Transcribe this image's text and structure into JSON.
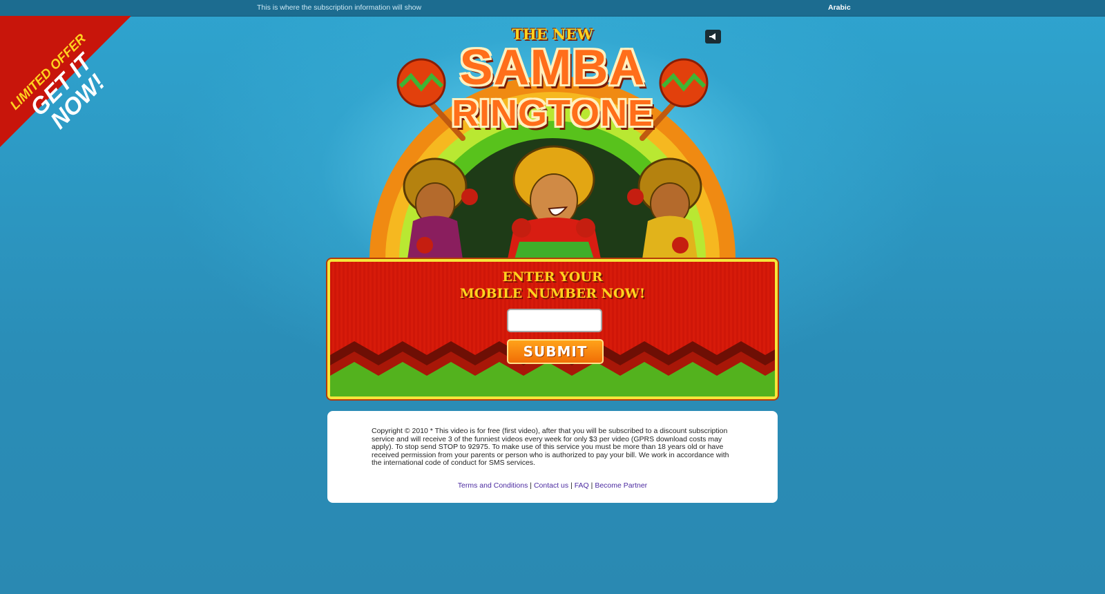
{
  "topbar": {
    "info_text": "This is where the subscription information will show",
    "language_link": "Arabic"
  },
  "ribbon": {
    "line1": "LIMITED OFFER",
    "line2": "GET IT NOW!"
  },
  "sound_button": {
    "icon": "speaker-icon"
  },
  "hero": {
    "title_small": "THE NEW",
    "title_big1": "SAMBA",
    "title_big2": "RINGTONE"
  },
  "form": {
    "heading_line1": "ENTER YOUR",
    "heading_line2": "MOBILE NUMBER NOW!",
    "mobile_value": "",
    "submit_label": "SUBMIT"
  },
  "footer": {
    "legal": "Copyright © 2010 * This video is for free (first video), after that you will be subscribed to a discount subscription service and will receive 3 of the funniest videos every week for only $3 per video (GPRS download costs may apply). To stop send STOP to 92975. To make use of this service you must be more than 18 years old or have received permission from your parents or person who is authorized to pay your bill. We work in accordance with the international code of conduct for SMS services.",
    "links": [
      "Terms and Conditions",
      "Contact us",
      "FAQ",
      "Become Partner"
    ],
    "separator": "|"
  },
  "colors": {
    "background": "#2a8db7",
    "topbar": "#1c6c90",
    "form_red": "#d71b0a",
    "form_border": "#f5e63a",
    "title_orange": "#ff6e1a",
    "heading_yellow": "#ffd21f",
    "link_purple": "#4b2aa0"
  }
}
